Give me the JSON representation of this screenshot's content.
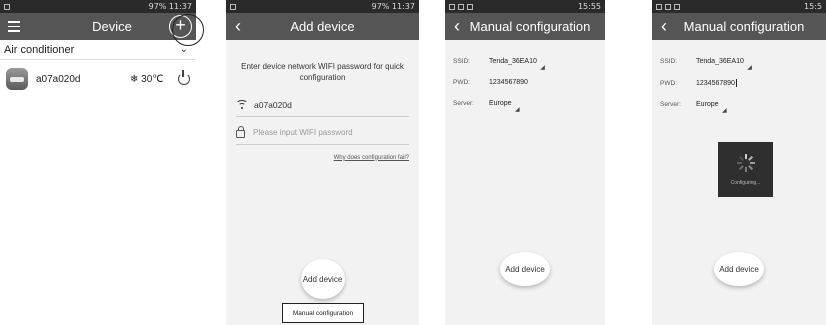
{
  "screens": [
    {
      "status": {
        "right": "97% 11:37"
      },
      "title": "Device",
      "category": "Air conditioner",
      "device": {
        "name": "a07a020d",
        "temp": "❄ 30℃"
      }
    },
    {
      "status": {
        "right": "97% 11:37"
      },
      "title": "Add device",
      "instruction": "Enter device network WIFI password for quick configuration",
      "ssid": "a07a020d",
      "password_placeholder": "Please input WIFI password",
      "help_link": "Why does configuration fail?",
      "add_button": "Add device",
      "manual_link": "Manual configuration"
    },
    {
      "status": {
        "right": "15:55"
      },
      "title": "Manual configuration",
      "ssid_label": "SSID:",
      "ssid_value": "Tenda_36EA10",
      "pwd_label": "PWD:",
      "pwd_value": "1234567890",
      "server_label": "Server:",
      "server_value": "Europe",
      "add_button": "Add device"
    },
    {
      "status": {
        "right": "15:5"
      },
      "title": "Manual configuration",
      "ssid_label": "SSID:",
      "ssid_value": "Tenda_36EA10",
      "pwd_label": "PWD:",
      "pwd_value": "1234567890",
      "server_label": "Server:",
      "server_value": "Europe",
      "loading_text": "Configuring...",
      "add_button": "Add device"
    }
  ]
}
